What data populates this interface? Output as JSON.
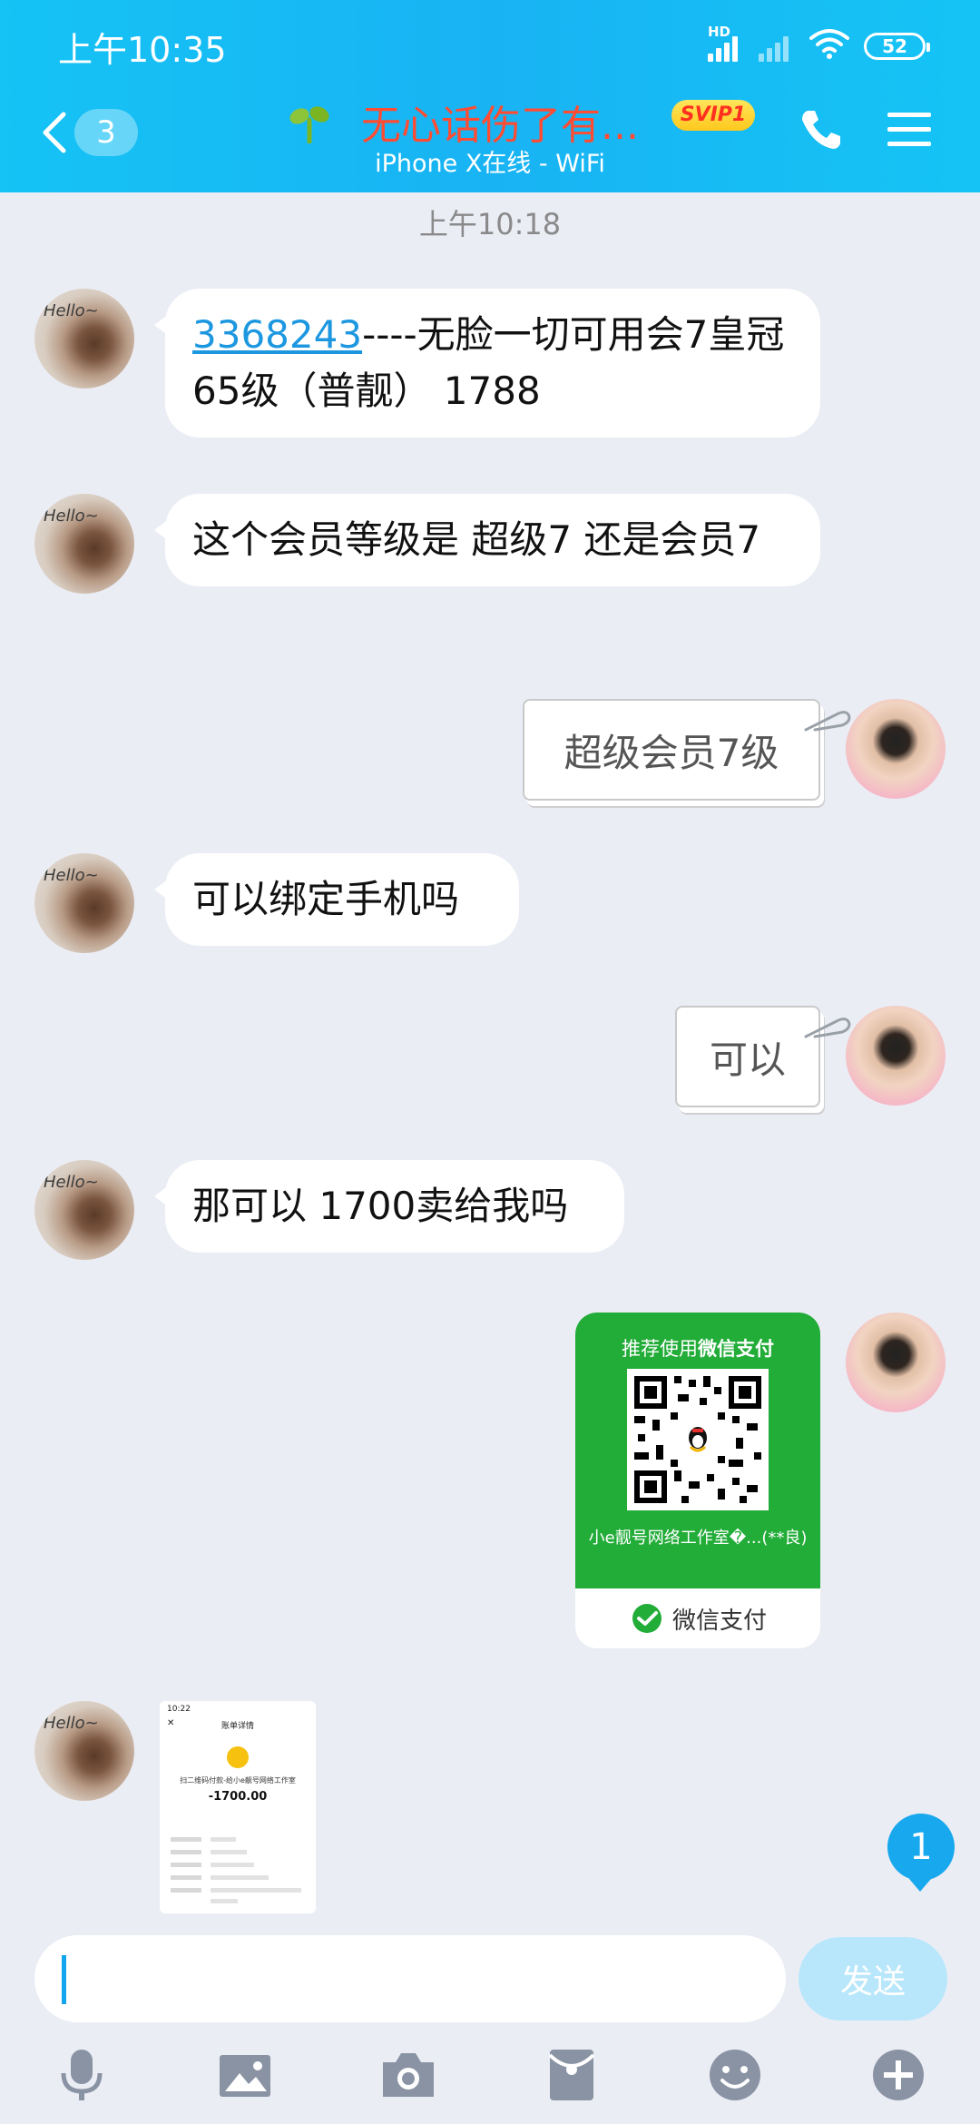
{
  "status_bar": {
    "time": "上午10:35",
    "signal_label": "HD",
    "battery": "52"
  },
  "header": {
    "back_count": "3",
    "title": "无心话伤了有...",
    "vip_badge": "SVIP1",
    "subtitle": "iPhone X在线 - WiFi",
    "icons": [
      "back-icon",
      "sprout-icon",
      "phone-icon",
      "menu-icon"
    ]
  },
  "chat": {
    "timestamp": "上午10:18",
    "messages": [
      {
        "from": "other",
        "link": "3368243",
        "text": "----无脸一切可用会7皇冠65级（普靓） 1788"
      },
      {
        "from": "other",
        "text": "这个会员等级是 超级7 还是会员7"
      },
      {
        "from": "me",
        "text": "超级会员7级"
      },
      {
        "from": "other",
        "text": "可以绑定手机吗"
      },
      {
        "from": "me",
        "text": "可以"
      },
      {
        "from": "other",
        "text": "那可以 1700卖给我吗"
      }
    ],
    "pay_card": {
      "recommend_prefix": "推荐使用",
      "recommend_brand": "微信支付",
      "merchant": "小e靓号网络工作室�...(**良)",
      "footer": "微信支付",
      "accent": "#22ac38"
    },
    "receipt_image": {
      "status_time": "10:22",
      "title": "账单详情",
      "merchant": "扫二维码付款-给小e靓号网络工作室",
      "amount": "-1700.00"
    },
    "unread_count": "1"
  },
  "composer": {
    "send_label": "发送",
    "tools": [
      "microphone-icon",
      "image-icon",
      "camera-icon",
      "red-packet-icon",
      "emoji-icon",
      "plus-icon"
    ]
  },
  "colors": {
    "header_blue": "#18b3f3",
    "title_red": "#ff4c32",
    "link_blue": "#1c97e0",
    "background": "#ebedf5"
  }
}
